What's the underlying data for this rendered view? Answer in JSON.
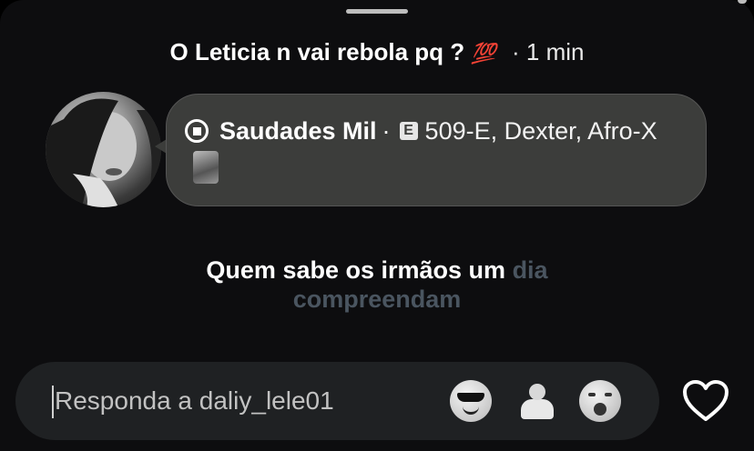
{
  "header": {
    "title": "O Leticia n vai rebola pq ?",
    "title_emoji": "💯",
    "time": "· 1 min"
  },
  "music": {
    "song": "Saudades Mil",
    "separator": "·",
    "explicit_badge": "E",
    "artists": "509-E, Dexter, Afro-X"
  },
  "lyrics": {
    "bright": "Quem sabe os irmãos um",
    "dim_inline": "dia",
    "dim_line2": "compreendam"
  },
  "reply": {
    "placeholder": "Responda a daliy_lele01"
  },
  "quick_reactions": [
    "😎",
    "🤷",
    "😱"
  ],
  "icons": {
    "music": "music-disc-icon",
    "like": "heart-icon"
  }
}
